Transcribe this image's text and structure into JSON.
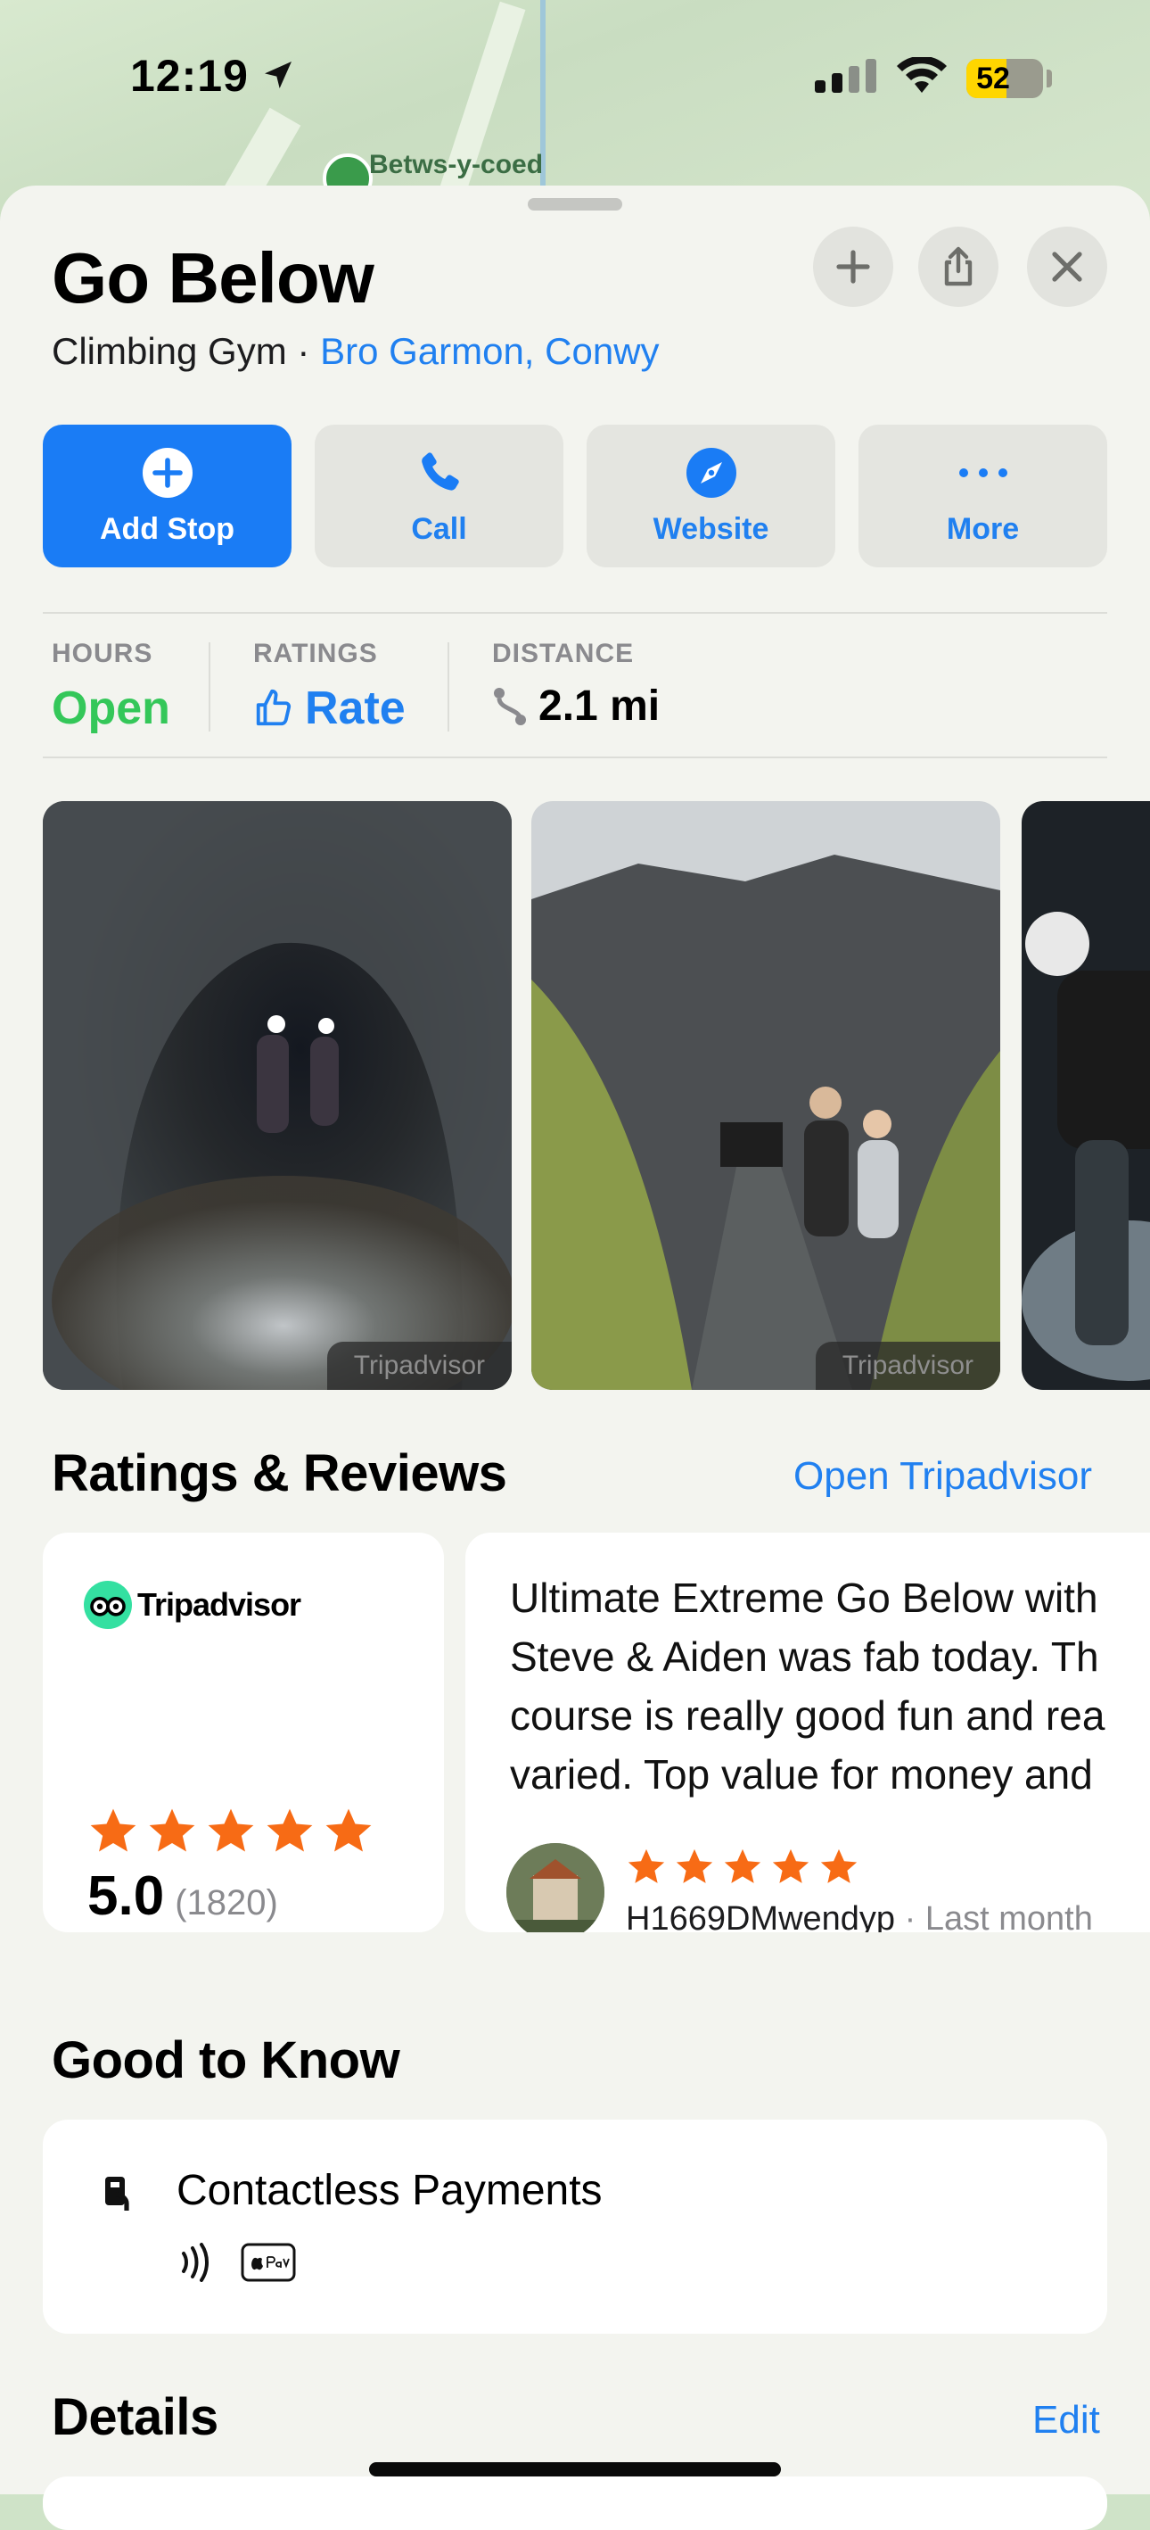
{
  "status_bar": {
    "time": "12:19",
    "battery": "52",
    "battery_level": 0.52
  },
  "map": {
    "place_label": "Betws-y-coed"
  },
  "place": {
    "name": "Go Below",
    "category": "Climbing Gym",
    "separator": "·",
    "location": "Bro Garmon, Conwy"
  },
  "actions": [
    {
      "label": "Add Stop",
      "icon": "plus-circle-icon"
    },
    {
      "label": "Call",
      "icon": "phone-icon"
    },
    {
      "label": "Website",
      "icon": "compass-icon"
    },
    {
      "label": "More",
      "icon": "ellipsis-icon"
    }
  ],
  "info": {
    "hours": {
      "label": "HOURS",
      "value": "Open"
    },
    "ratings": {
      "label": "RATINGS",
      "value": "Rate"
    },
    "distance": {
      "label": "DISTANCE",
      "value": "2.1 mi"
    }
  },
  "photos": {
    "credit": "Tripadvisor"
  },
  "ratings_reviews": {
    "title": "Ratings & Reviews",
    "link": "Open Tripadvisor",
    "provider": "Tripadvisor",
    "stars": 5,
    "score": "5.0",
    "count": "(1820)",
    "review": {
      "lines": [
        "Ultimate Extreme Go Below with",
        "Steve & Aiden was fab today. Th",
        "course is really good fun and rea",
        "varied. Top value for money and"
      ],
      "stars": 5,
      "author": "H1669DMwendyp",
      "meta": " · Last month"
    }
  },
  "good_to_know": {
    "title": "Good to Know",
    "item": "Contactless Payments"
  },
  "details": {
    "title": "Details",
    "edit": "Edit"
  },
  "colors": {
    "accent": "#1a7cf5",
    "open_green": "#34c759",
    "star_orange": "#f76b15"
  }
}
